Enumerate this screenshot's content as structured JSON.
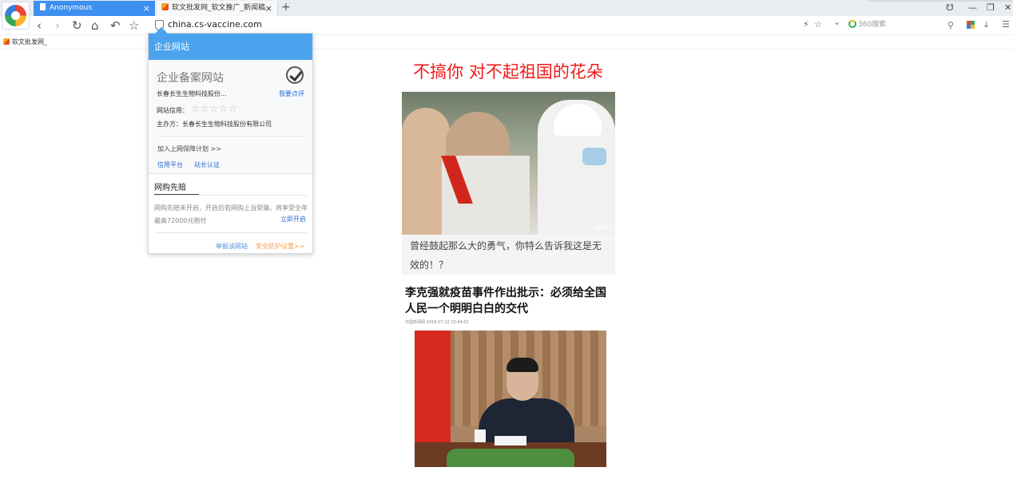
{
  "tabs": [
    {
      "title": "Anonymous",
      "active": true
    },
    {
      "title": "软文批发网_软文推广_新闻稿发",
      "active": false
    }
  ],
  "tab_close_glyph": "×",
  "new_tab_glyph": "+",
  "window_controls": {
    "skin": "☋",
    "minimize": "—",
    "restore": "❐",
    "close": "✕"
  },
  "toolbar": {
    "back": "‹",
    "forward": "›",
    "reload": "↻",
    "home": "⌂",
    "undo": "↶",
    "favorite": "☆",
    "url": "china.cs-vaccine.com",
    "flash": "⚡",
    "star": "☆",
    "dropdown": "⌄",
    "search_placeholder": "360搜索",
    "search_glyph": "⚲",
    "download": "⤓",
    "menu": "☰"
  },
  "bookmarks": [
    {
      "label": "软文批发网_"
    }
  ],
  "popup": {
    "header": "企业网站",
    "cert_title": "企业备案网站",
    "company_short": "长春长生生物科技股份...",
    "rate_link": "我要点评",
    "credit_label": "网站信用：",
    "stars": "☆☆☆☆☆",
    "host_label": "主办方：长春长生生物科技股份有限公司",
    "join_link": "加入上网保障计划 >>",
    "link_credit": "信用平台",
    "link_owner": "站长认证",
    "sec2_title": "网购先赔",
    "sec2_desc": "网购先赔未开启，开启后若网购上当受骗，将享受全年最高72000元赔付",
    "open_link": "立即开启",
    "report_link": "举报该网站",
    "safety_link": "安全防护设置>>"
  },
  "article": {
    "headline": "不搞你 对不起祖国的花朵",
    "photo1_watermark": "一社图片",
    "caption": "曾经鼓起那么大的勇气，你特么告诉我这是无效的！？",
    "news_title": "李克强就疫苗事件作出批示：必须给全国人民一个明明白白的交代",
    "news_meta": "中国新闻网 2018-07-22 23:44:02"
  },
  "colors": {
    "active_tab": "#3d8ff0",
    "popup_header": "#4aa3ec",
    "headline_red": "#f01919",
    "link_blue": "#2f6fd3",
    "safety_orange": "#f39c4b"
  }
}
